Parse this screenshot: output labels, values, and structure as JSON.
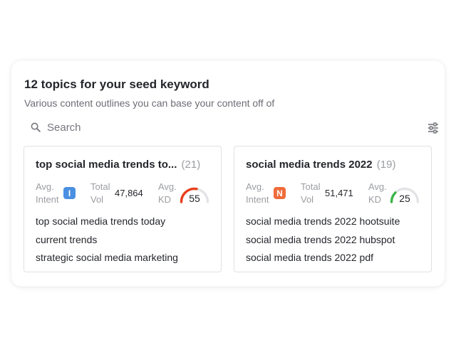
{
  "header": {
    "title": "12 topics for your seed keyword",
    "subtitle": "Various content outlines you can base your content off of"
  },
  "search": {
    "placeholder": "Search",
    "value": ""
  },
  "labels": {
    "intent_line1": "Avg.",
    "intent_line2": "Intent",
    "vol_line1": "Total",
    "vol_line2": "Vol",
    "kd_line1": "Avg.",
    "kd_line2": "KD"
  },
  "cards": [
    {
      "title": "top social media trends to...",
      "count": "(21)",
      "intent": "I",
      "intent_color": "#4a90e2",
      "total_vol": "47,864",
      "kd": "55",
      "kd_color": "#e8401c",
      "keywords": [
        "top social media trends today",
        "current trends",
        "strategic social media marketing"
      ]
    },
    {
      "title": "social media trends 2022",
      "count": "(19)",
      "intent": "N",
      "intent_color": "#ef6c3a",
      "total_vol": "51,471",
      "kd": "25",
      "kd_color": "#3bb54a",
      "keywords": [
        "social media trends 2022 hootsuite",
        "social media trends 2022 hubspot",
        "social media trends 2022 pdf"
      ]
    }
  ],
  "colors": {
    "gauge_track": "#e3e4e7"
  }
}
